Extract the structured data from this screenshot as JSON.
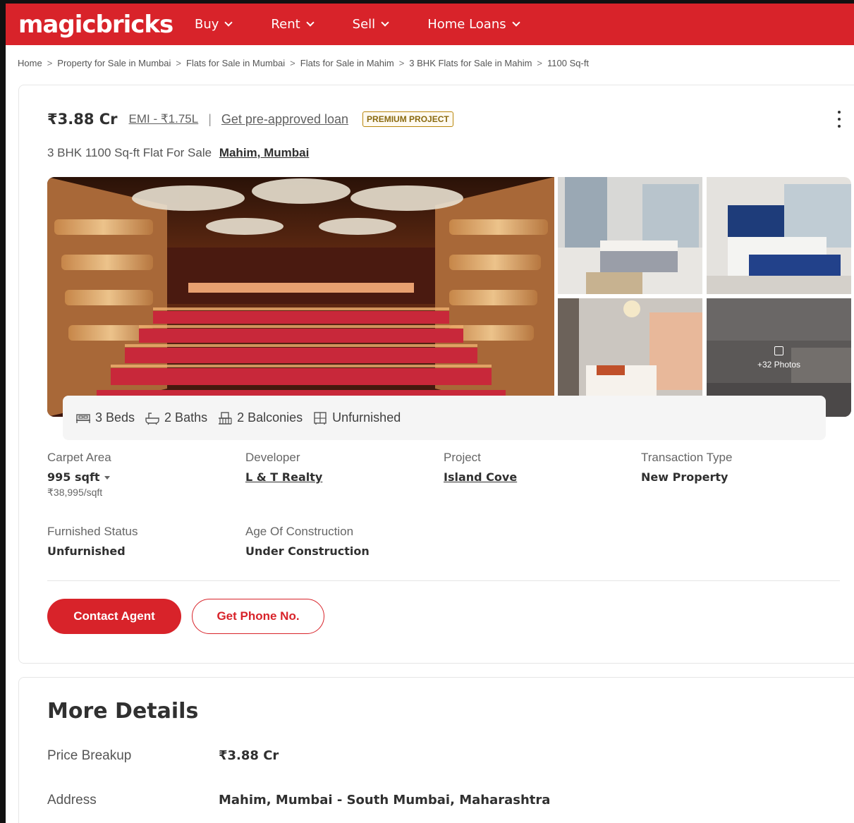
{
  "header": {
    "logo": "magicbricks",
    "nav": [
      {
        "label": "Buy"
      },
      {
        "label": "Rent"
      },
      {
        "label": "Sell"
      },
      {
        "label": "Home Loans"
      }
    ]
  },
  "breadcrumb": [
    "Home",
    "Property for Sale in Mumbai",
    "Flats for Sale in Mumbai",
    "Flats for Sale in Mahim",
    "3 BHK Flats for Sale in Mahim",
    "1100 Sq-ft"
  ],
  "listing": {
    "price": "₹3.88 Cr",
    "emi": "EMI - ₹1.75L",
    "loan_link": "Get pre-approved loan",
    "badge": "PREMIUM PROJECT",
    "subtitle": "3 BHK 1100 Sq-ft Flat For Sale",
    "location": "Mahim, Mumbai",
    "photos_label": "+32 Photos",
    "amenities": [
      {
        "icon": "bed-icon",
        "label": "3 Beds"
      },
      {
        "icon": "bath-icon",
        "label": "2 Baths"
      },
      {
        "icon": "balcony-icon",
        "label": "2 Balconies"
      },
      {
        "icon": "furnishing-icon",
        "label": "Unfurnished"
      }
    ],
    "attributes": {
      "carpet_area": {
        "label": "Carpet Area",
        "value": "995 sqft",
        "sub": "₹38,995/sqft"
      },
      "developer": {
        "label": "Developer",
        "value": "L & T Realty"
      },
      "project": {
        "label": "Project",
        "value": "Island Cove"
      },
      "transaction": {
        "label": "Transaction Type",
        "value": "New Property"
      },
      "furnished": {
        "label": "Furnished Status",
        "value": "Unfurnished"
      },
      "age": {
        "label": "Age Of Construction",
        "value": "Under Construction"
      }
    },
    "buttons": {
      "contact": "Contact Agent",
      "phone": "Get Phone No."
    }
  },
  "more_details": {
    "title": "More Details",
    "rows": [
      {
        "label": "Price Breakup",
        "value": "₹3.88 Cr"
      },
      {
        "label": "Address",
        "value": "Mahim, Mumbai - South Mumbai, Maharashtra"
      }
    ]
  },
  "colors": {
    "brand_red": "#d8232a",
    "premium_gold": "#b8860b"
  }
}
